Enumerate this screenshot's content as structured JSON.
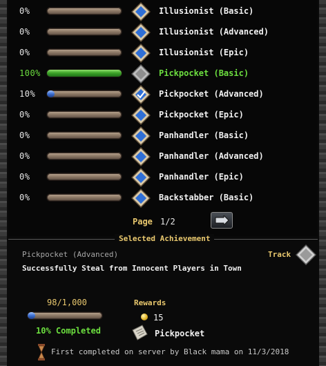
{
  "achievements": [
    {
      "percent": "0%",
      "progress": 0,
      "name": "Illusionist (Basic)",
      "state": "locked"
    },
    {
      "percent": "0%",
      "progress": 0,
      "name": "Illusionist (Advanced)",
      "state": "locked"
    },
    {
      "percent": "0%",
      "progress": 0,
      "name": "Illusionist (Epic)",
      "state": "locked"
    },
    {
      "percent": "100%",
      "progress": 1.0,
      "name": "Pickpocket (Basic)",
      "state": "complete"
    },
    {
      "percent": "10%",
      "progress": 0.1,
      "name": "Pickpocket (Advanced)",
      "state": "tracked"
    },
    {
      "percent": "0%",
      "progress": 0,
      "name": "Pickpocket (Epic)",
      "state": "locked"
    },
    {
      "percent": "0%",
      "progress": 0,
      "name": "Panhandler (Basic)",
      "state": "locked"
    },
    {
      "percent": "0%",
      "progress": 0,
      "name": "Panhandler (Advanced)",
      "state": "locked"
    },
    {
      "percent": "0%",
      "progress": 0,
      "name": "Panhandler (Epic)",
      "state": "locked"
    },
    {
      "percent": "0%",
      "progress": 0,
      "name": "Backstabber (Basic)",
      "state": "locked"
    }
  ],
  "pager": {
    "label": "Page",
    "value": "1/2",
    "next_icon": "next-page-arrow-icon"
  },
  "selected": {
    "section_title": "Selected Achievement",
    "name": "Pickpocket (Advanced)",
    "description": "Successfully Steal from Innocent Players in Town",
    "track_label": "Track",
    "count": "98/1,000",
    "progress": 0.098,
    "completed_text": "10% Completed",
    "rewards_title": "Rewards",
    "gold_amount": "15",
    "title_reward": "Pickpocket",
    "first_completed": "First completed on server by Black mama on 11/3/2018"
  },
  "colors": {
    "accent_gold": "#e9c86e",
    "complete_green": "#6cde3f",
    "badge_blue": "#2f6fd6"
  }
}
